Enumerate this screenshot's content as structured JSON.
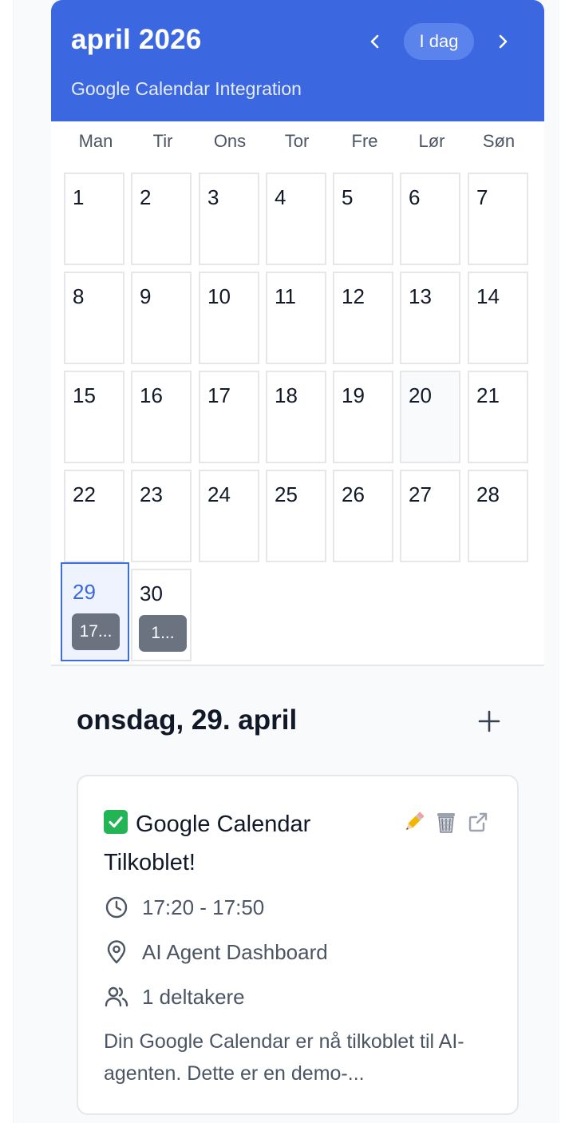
{
  "header": {
    "month_title": "april 2026",
    "subtitle": "Google Calendar Integration",
    "today_label": "I dag",
    "prev_icon": "chevron-left-icon",
    "next_icon": "chevron-right-icon"
  },
  "weekdays": [
    "Man",
    "Tir",
    "Ons",
    "Tor",
    "Fre",
    "Lør",
    "Søn"
  ],
  "days": [
    "1",
    "2",
    "3",
    "4",
    "5",
    "6",
    "7",
    "8",
    "9",
    "10",
    "11",
    "12",
    "13",
    "14",
    "15",
    "16",
    "17",
    "18",
    "19",
    "20",
    "21",
    "22",
    "23",
    "24",
    "25",
    "26",
    "27",
    "28",
    "29",
    "30"
  ],
  "highlighted_day": "20",
  "selected_day": "29",
  "day_events": {
    "29": "17...",
    "30": "1..."
  },
  "colors": {
    "header_blue": "#3b67e1",
    "today_button": "#5b83ec",
    "event_chip": "#6b7280",
    "selected_border": "#3b6fe0"
  },
  "details": {
    "title": "onsdag, 29. april",
    "add_icon": "plus-icon",
    "event": {
      "title": "Google Calendar Tilkoblet!",
      "status_icon": "check-mark-icon",
      "actions": [
        "pencil-icon",
        "trash-icon",
        "external-link-icon"
      ],
      "time": "17:20 - 17:50",
      "location": "AI Agent Dashboard",
      "attendees": "1 deltakere",
      "description": "Din Google Calendar er nå tilkoblet til AI-agenten. Dette er en demo-..."
    }
  }
}
